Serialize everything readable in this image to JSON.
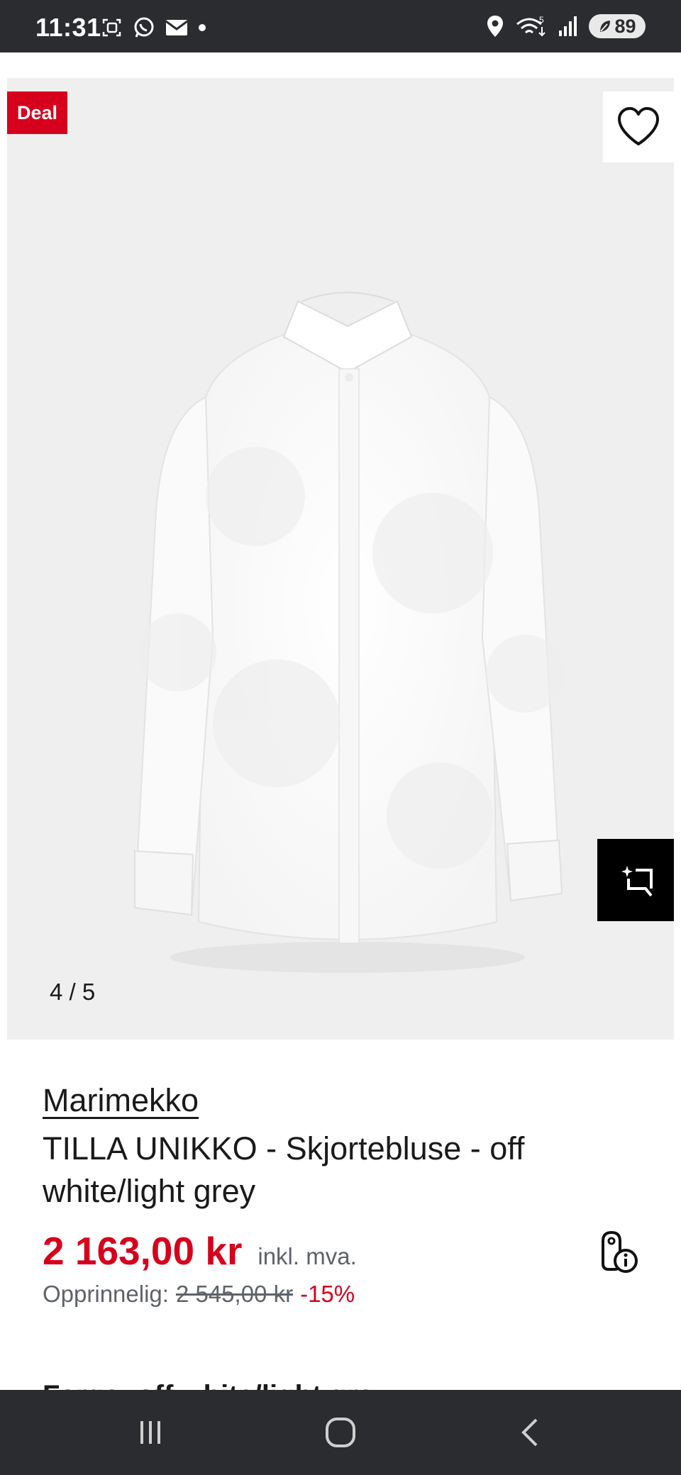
{
  "status_bar": {
    "time": "11:31",
    "battery": "89",
    "network": "5"
  },
  "gallery": {
    "deal_label": "Deal",
    "counter": "4 / 5",
    "current_index": 4,
    "total": 5
  },
  "product": {
    "brand": "Marimekko",
    "title": "TILLA UNIKKO - Skjortebluse - off white/light grey",
    "price": "2 163,00 kr",
    "vat_note": "inkl. mva.",
    "original_label": "Opprinnelig:",
    "original_price": "2 545,00 kr",
    "discount": "-15%"
  },
  "peek": {
    "text": "Farge: off white/light grey"
  },
  "colors": {
    "accent": "#d6001c",
    "bars": "#2b2c30",
    "image_bg": "#efefef"
  },
  "icons": {
    "wishlist": "heart-icon",
    "compare": "compare-icon",
    "price_info": "price-tag-info-icon"
  }
}
